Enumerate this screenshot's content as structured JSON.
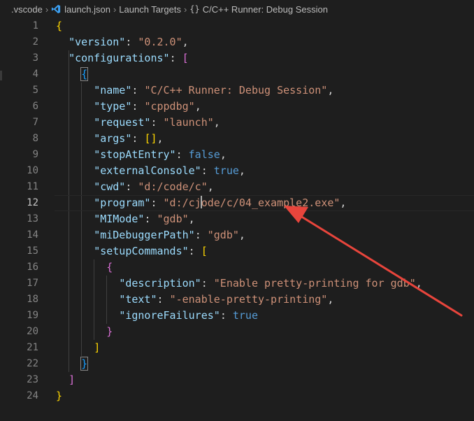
{
  "breadcrumb": {
    "folder": ".vscode",
    "file": "launch.json",
    "section": "Launch Targets",
    "item": "C/C++ Runner: Debug Session"
  },
  "editor": {
    "active_line": 12,
    "lines": [
      {
        "n": "1",
        "tokens": [
          {
            "t": "{",
            "c": "br1"
          }
        ]
      },
      {
        "n": "2",
        "tokens": [
          {
            "t": "  "
          },
          {
            "t": "\"version\"",
            "c": "k"
          },
          {
            "t": ": "
          },
          {
            "t": "\"0.2.0\"",
            "c": "s"
          },
          {
            "t": ","
          }
        ]
      },
      {
        "n": "3",
        "tokens": [
          {
            "t": "  "
          },
          {
            "t": "\"configurations\"",
            "c": "k"
          },
          {
            "t": ": "
          },
          {
            "t": "[",
            "c": "br2"
          }
        ]
      },
      {
        "n": "4",
        "tokens": [
          {
            "t": "    "
          },
          {
            "t": "{",
            "c": "br3"
          }
        ]
      },
      {
        "n": "5",
        "tokens": [
          {
            "t": "      "
          },
          {
            "t": "\"name\"",
            "c": "k"
          },
          {
            "t": ": "
          },
          {
            "t": "\"C/C++ Runner: Debug Session\"",
            "c": "s"
          },
          {
            "t": ","
          }
        ]
      },
      {
        "n": "6",
        "tokens": [
          {
            "t": "      "
          },
          {
            "t": "\"type\"",
            "c": "k"
          },
          {
            "t": ": "
          },
          {
            "t": "\"cppdbg\"",
            "c": "s"
          },
          {
            "t": ","
          }
        ]
      },
      {
        "n": "7",
        "tokens": [
          {
            "t": "      "
          },
          {
            "t": "\"request\"",
            "c": "k"
          },
          {
            "t": ": "
          },
          {
            "t": "\"launch\"",
            "c": "s"
          },
          {
            "t": ","
          }
        ]
      },
      {
        "n": "8",
        "tokens": [
          {
            "t": "      "
          },
          {
            "t": "\"args\"",
            "c": "k"
          },
          {
            "t": ": "
          },
          {
            "t": "[]",
            "c": "br1"
          },
          {
            "t": ","
          }
        ]
      },
      {
        "n": "9",
        "tokens": [
          {
            "t": "      "
          },
          {
            "t": "\"stopAtEntry\"",
            "c": "k"
          },
          {
            "t": ": "
          },
          {
            "t": "false",
            "c": "b"
          },
          {
            "t": ","
          }
        ]
      },
      {
        "n": "10",
        "tokens": [
          {
            "t": "      "
          },
          {
            "t": "\"externalConsole\"",
            "c": "k"
          },
          {
            "t": ": "
          },
          {
            "t": "true",
            "c": "b"
          },
          {
            "t": ","
          }
        ]
      },
      {
        "n": "11",
        "tokens": [
          {
            "t": "      "
          },
          {
            "t": "\"cwd\"",
            "c": "k"
          },
          {
            "t": ": "
          },
          {
            "t": "\"d:/code/c\"",
            "c": "s"
          },
          {
            "t": ","
          }
        ]
      },
      {
        "n": "12",
        "tokens": [
          {
            "t": "      "
          },
          {
            "t": "\"program\"",
            "c": "k"
          },
          {
            "t": ": "
          },
          {
            "t": "\"d:/cj",
            "c": "s"
          },
          {
            "t": "|",
            "c": "caret"
          },
          {
            "t": "ode/c/04_example2.exe\"",
            "c": "s"
          },
          {
            "t": ","
          }
        ]
      },
      {
        "n": "13",
        "tokens": [
          {
            "t": "      "
          },
          {
            "t": "\"MIMode\"",
            "c": "k"
          },
          {
            "t": ": "
          },
          {
            "t": "\"gdb\"",
            "c": "s"
          },
          {
            "t": ","
          }
        ]
      },
      {
        "n": "14",
        "tokens": [
          {
            "t": "      "
          },
          {
            "t": "\"miDebuggerPath\"",
            "c": "k"
          },
          {
            "t": ": "
          },
          {
            "t": "\"gdb\"",
            "c": "s"
          },
          {
            "t": ","
          }
        ]
      },
      {
        "n": "15",
        "tokens": [
          {
            "t": "      "
          },
          {
            "t": "\"setupCommands\"",
            "c": "k"
          },
          {
            "t": ": "
          },
          {
            "t": "[",
            "c": "br1"
          }
        ]
      },
      {
        "n": "16",
        "tokens": [
          {
            "t": "        "
          },
          {
            "t": "{",
            "c": "br2"
          }
        ]
      },
      {
        "n": "17",
        "tokens": [
          {
            "t": "          "
          },
          {
            "t": "\"description\"",
            "c": "k"
          },
          {
            "t": ": "
          },
          {
            "t": "\"Enable pretty-printing for gdb\"",
            "c": "s"
          },
          {
            "t": ","
          }
        ]
      },
      {
        "n": "18",
        "tokens": [
          {
            "t": "          "
          },
          {
            "t": "\"text\"",
            "c": "k"
          },
          {
            "t": ": "
          },
          {
            "t": "\"-enable-pretty-printing\"",
            "c": "s"
          },
          {
            "t": ","
          }
        ]
      },
      {
        "n": "19",
        "tokens": [
          {
            "t": "          "
          },
          {
            "t": "\"ignoreFailures\"",
            "c": "k"
          },
          {
            "t": ": "
          },
          {
            "t": "true",
            "c": "b"
          }
        ]
      },
      {
        "n": "20",
        "tokens": [
          {
            "t": "        "
          },
          {
            "t": "}",
            "c": "br2"
          }
        ]
      },
      {
        "n": "21",
        "tokens": [
          {
            "t": "      "
          },
          {
            "t": "]",
            "c": "br1"
          }
        ]
      },
      {
        "n": "22",
        "tokens": [
          {
            "t": "    "
          },
          {
            "t": "}",
            "c": "br3"
          }
        ]
      },
      {
        "n": "23",
        "tokens": [
          {
            "t": "  "
          },
          {
            "t": "]",
            "c": "br2"
          }
        ]
      },
      {
        "n": "24",
        "tokens": [
          {
            "t": "}",
            "c": "br1"
          }
        ]
      }
    ]
  },
  "annotation": {
    "arrow_color": "#e8453c"
  }
}
